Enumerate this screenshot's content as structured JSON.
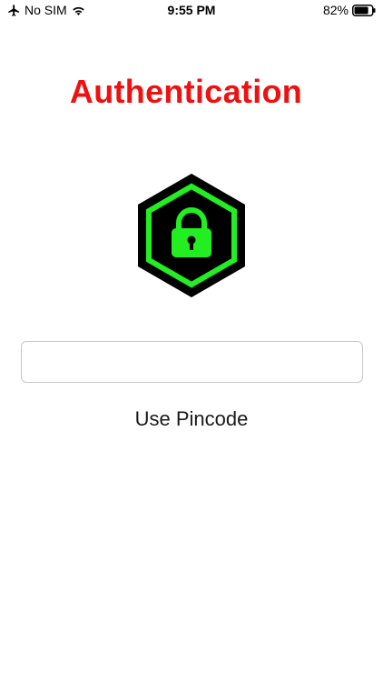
{
  "status_bar": {
    "carrier": "No SIM",
    "time": "9:55 PM",
    "battery_percent": "82%",
    "battery_level": 0.82,
    "icons": [
      "airplane-icon",
      "wifi-icon",
      "battery-icon"
    ]
  },
  "title": "Authentication",
  "emblem": {
    "icon": "lock-icon",
    "hex_color": "#000000",
    "accent_color": "#22ee22"
  },
  "pin_input": {
    "value": "",
    "placeholder": ""
  },
  "use_pincode_label": "Use Pincode",
  "colors": {
    "title": "#ee1111",
    "accent": "#22ee22",
    "background": "#ffffff"
  }
}
